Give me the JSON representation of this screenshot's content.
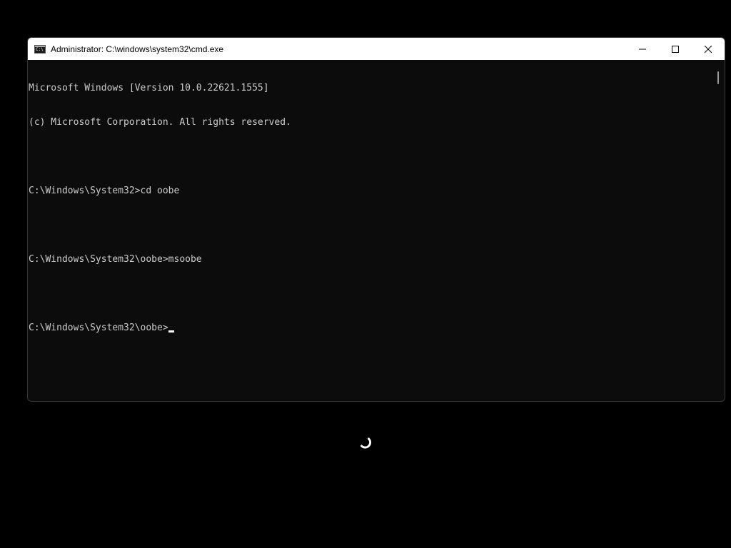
{
  "window": {
    "title": "Administrator: C:\\windows\\system32\\cmd.exe",
    "app_icon_glyph": "C:\\"
  },
  "console": {
    "lines": [
      "Microsoft Windows [Version 10.0.22621.1555]",
      "(c) Microsoft Corporation. All rights reserved.",
      "",
      "C:\\Windows\\System32>cd oobe",
      "",
      "C:\\Windows\\System32\\oobe>msoobe",
      "",
      "C:\\Windows\\System32\\oobe>"
    ]
  },
  "icons": {
    "app": "cmd-icon",
    "minimize": "minimize-icon",
    "maximize": "maximize-icon",
    "close": "close-icon",
    "loading": "loading-spinner-icon"
  },
  "colors": {
    "desktop_background": "#000000",
    "console_background": "#0c0c0c",
    "console_text": "#cccccc",
    "titlebar_background": "#ffffff"
  }
}
